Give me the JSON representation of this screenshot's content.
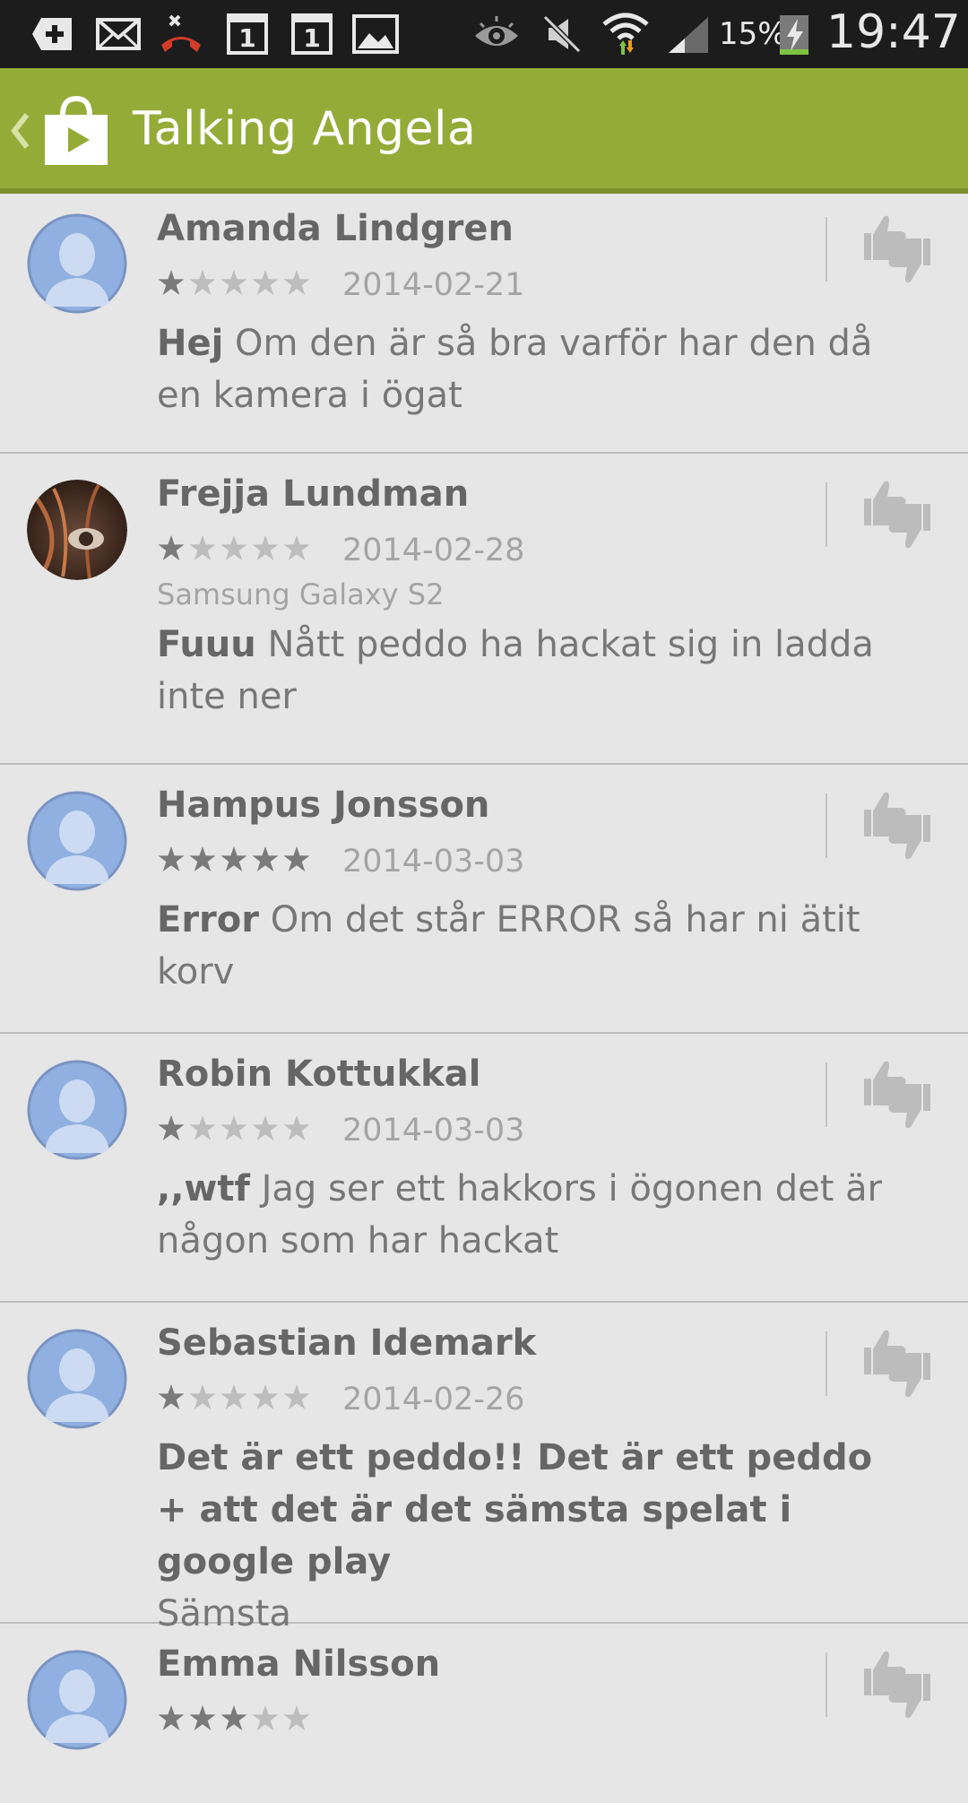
{
  "status_bar": {
    "battery_percent": "15%",
    "time": "19:47",
    "calendar_day_1": "1",
    "calendar_day_2": "1"
  },
  "action_bar": {
    "title": "Talking Angela"
  },
  "reviews": [
    {
      "author": "Amanda Lindgren",
      "rating": 1,
      "date": "2014-02-21",
      "device": "",
      "title": "Hej",
      "text": "Om den är så bra varför har den då en kamera i ögat"
    },
    {
      "author": "Frejja Lundman",
      "rating": 1,
      "date": "2014-02-28",
      "device": "Samsung Galaxy S2",
      "title": "Fuuu",
      "text": "Nått peddo ha hackat sig in ladda inte ner"
    },
    {
      "author": "Hampus Jonsson",
      "rating": 5,
      "date": "2014-03-03",
      "device": "",
      "title": "Error",
      "text": "Om det står ERROR så har ni ätit korv"
    },
    {
      "author": "Robin Kottukkal",
      "rating": 1,
      "date": "2014-03-03",
      "device": "",
      "title": ",,wtf",
      "text": "Jag ser ett hakkors i ögonen det är någon som har hackat"
    },
    {
      "author": "Sebastian Idemark",
      "rating": 1,
      "date": "2014-02-26",
      "device": "",
      "title": "Det är ett peddo!! Det är ett peddo + att det är det sämsta spelat i google play",
      "text": "Sämsta"
    },
    {
      "author": "Emma Nilsson",
      "rating": 3,
      "date": "",
      "device": "",
      "title": "",
      "text": ""
    }
  ],
  "colors": {
    "action_bar": "#95ab38",
    "background": "#e6e6e6",
    "avatar_placeholder": "#8fb0e0",
    "star_filled": "#7a7a7a",
    "star_empty": "#bdbdbd"
  }
}
